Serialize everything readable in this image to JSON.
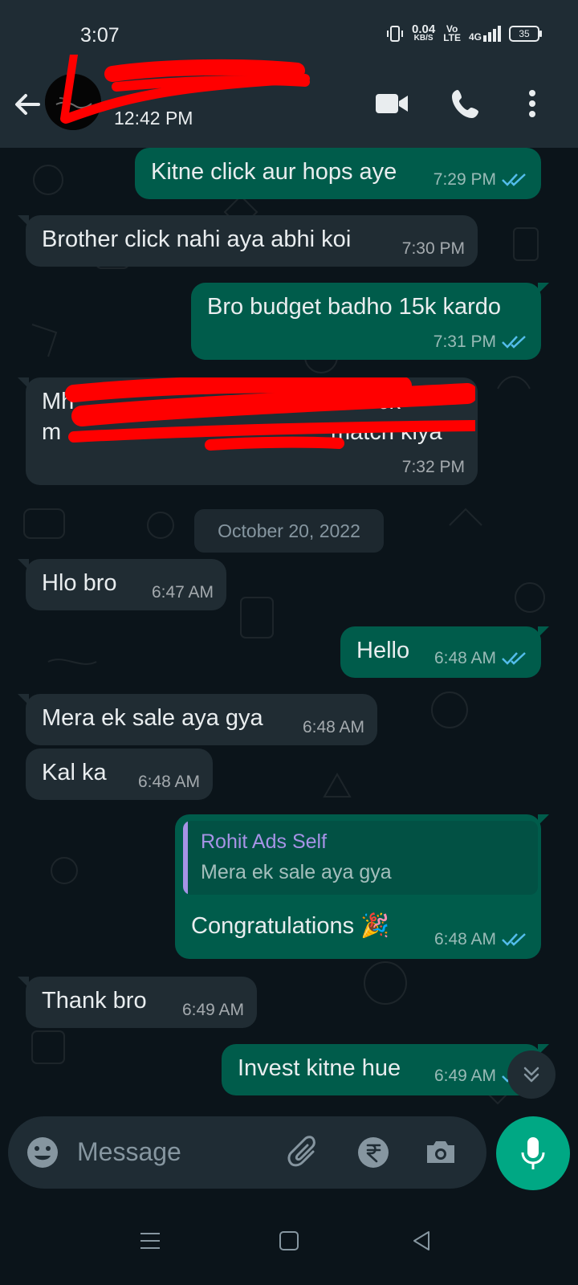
{
  "status_bar": {
    "time": "3:07",
    "net_speed_value": "0.04",
    "net_speed_unit": "KB/S",
    "volte_top": "Vo",
    "volte_bottom": "LTE",
    "network": "4G",
    "battery": "35"
  },
  "header": {
    "last_seen": "12:42 PM"
  },
  "date_separator": "October 20, 2022",
  "messages": [
    {
      "dir": "out",
      "text": "Kitne click aur hops aye",
      "time": "7:29 PM"
    },
    {
      "dir": "in",
      "text": "Brother click nahi aya abhi koi",
      "time": "7:30 PM"
    },
    {
      "dir": "out",
      "text": "Bro budget badho 15k kardo",
      "time": "7:31 PM"
    },
    {
      "dir": "in",
      "text_line1": "Mh",
      "text_line1_end": "ck",
      "text_line2": "m",
      "text_line2_end": "match kiya",
      "time": "7:32 PM"
    },
    {
      "dir": "in",
      "text": "Hlo bro",
      "time": "6:47 AM"
    },
    {
      "dir": "out",
      "text": "Hello",
      "time": "6:48 AM"
    },
    {
      "dir": "in",
      "text": "Mera ek sale aya gya",
      "time": "6:48 AM"
    },
    {
      "dir": "in",
      "text": "Kal ka",
      "time": "6:48 AM"
    },
    {
      "dir": "out",
      "reply_name": "Rohit Ads Self",
      "reply_text": "Mera ek sale aya gya",
      "text": "Congratulations 🎉",
      "time": "6:48 AM"
    },
    {
      "dir": "in",
      "text": "Thank bro",
      "time": "6:49 AM"
    },
    {
      "dir": "out",
      "text": "Invest kitne hue",
      "time": "6:49 AM"
    }
  ],
  "input": {
    "placeholder": "Message"
  },
  "colors": {
    "header_bg": "#1f2c34",
    "chat_bg": "#0b141a",
    "incoming_bubble": "#202c33",
    "outgoing_bubble": "#005c4b",
    "accent": "#00a884",
    "read_ticks": "#53bdeb",
    "reply_name": "#a693e6"
  },
  "icons": [
    "back-arrow-icon",
    "video-call-icon",
    "phone-icon",
    "more-options-icon",
    "emoji-icon",
    "attach-icon",
    "rupee-payment-icon",
    "camera-icon",
    "mic-icon",
    "scroll-down-icon",
    "nav-menu-icon",
    "nav-home-icon",
    "nav-back-icon"
  ]
}
